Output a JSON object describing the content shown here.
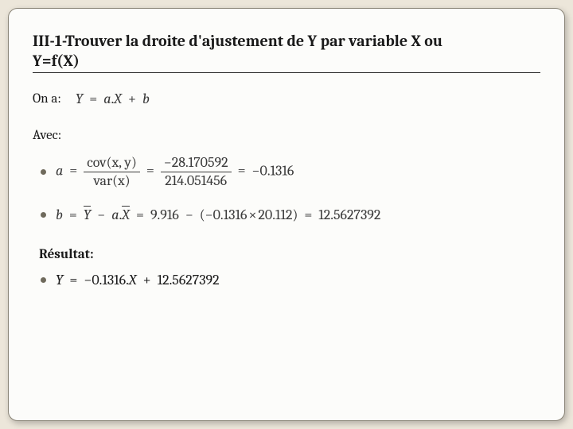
{
  "title_line1": "III-1-Trouver  la droite d'ajustement de Y par variable X ou",
  "title_line2": "Y=f(X)",
  "labels": {
    "on_a": "On a:",
    "avec": "Avec:",
    "resultat": "Résultat:"
  },
  "eq_line": {
    "Y": "Y",
    "eq": "=",
    "a": "a",
    "dot": ".",
    "X": "X",
    "plus": "+",
    "b": "b"
  },
  "eq_a": {
    "lhs": "a",
    "eq": "=",
    "frac1_num_cov": "cov",
    "frac1_num_args": "(x, y)",
    "frac1_den_var": "var",
    "frac1_den_args": "(x)",
    "frac2_num": "−28.170592",
    "frac2_den": "214.051456",
    "rhs": "−0.1316"
  },
  "eq_b": {
    "lhs": "b",
    "eq": "=",
    "Ybar": "Y",
    "minus": "−",
    "a": "a",
    "dot": ".",
    "Xbar": "X",
    "eq2": "=",
    "v_ybar": "9.916",
    "minus2": "−",
    "open": "(",
    "neg_a": "−0.1316",
    "times": "×",
    "v_xbar": "20.112",
    "close": ")",
    "rhs": "12.5627392"
  },
  "eq_result": {
    "Y": "Y",
    "eq": "=",
    "coef": "−0.1316",
    "dot": ".",
    "X": "X",
    "plus": "+",
    "intercept": "12.5627392"
  }
}
